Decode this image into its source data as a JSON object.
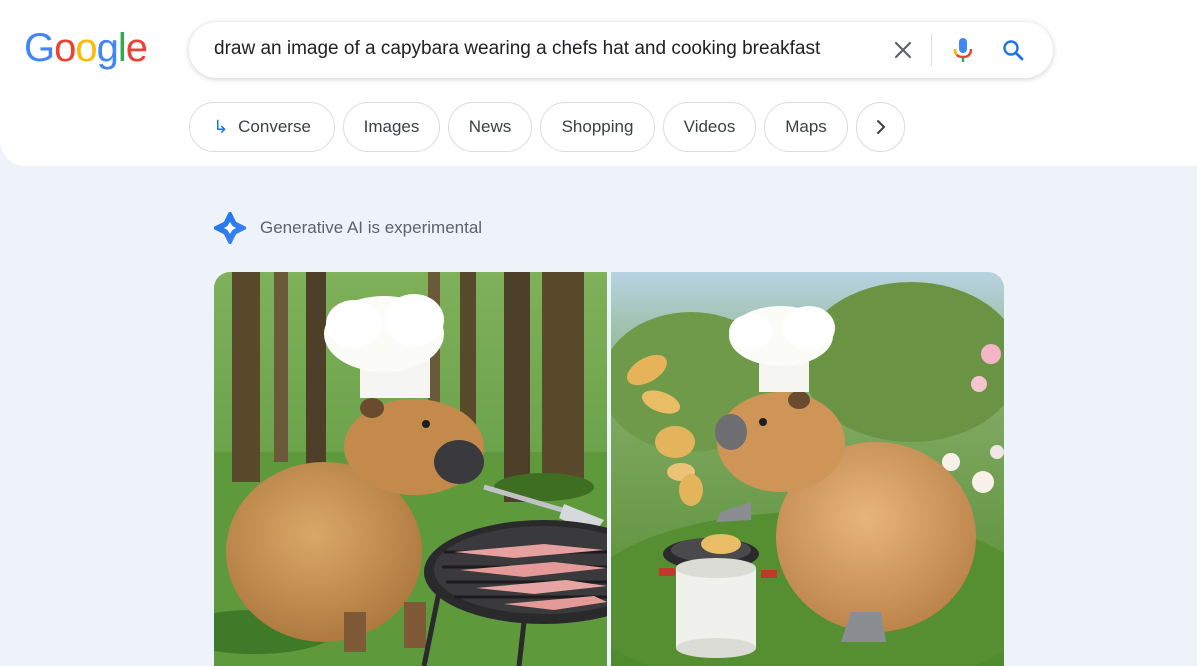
{
  "logo": {
    "text": "Google",
    "letters": [
      "G",
      "o",
      "o",
      "g",
      "l",
      "e"
    ],
    "colors": [
      "#4285f4",
      "#ea4335",
      "#fbbc05",
      "#4285f4",
      "#34a853",
      "#ea4335"
    ]
  },
  "search": {
    "query": "draw an image of a capybara wearing a chefs hat and cooking breakfast",
    "icons": [
      "close-icon",
      "microphone-icon",
      "search-icon"
    ]
  },
  "chips": {
    "converse": "Converse",
    "images": "Images",
    "news": "News",
    "shopping": "Shopping",
    "videos": "Videos",
    "maps": "Maps",
    "more_icon": "chevron-right-icon"
  },
  "ai_banner": {
    "label": "Generative AI is experimental",
    "icon": "gemini-sparkle-icon"
  },
  "colors": {
    "accent": "#1a73e8",
    "page_bg": "#eef2f9",
    "header_bg": "#ffffff"
  }
}
